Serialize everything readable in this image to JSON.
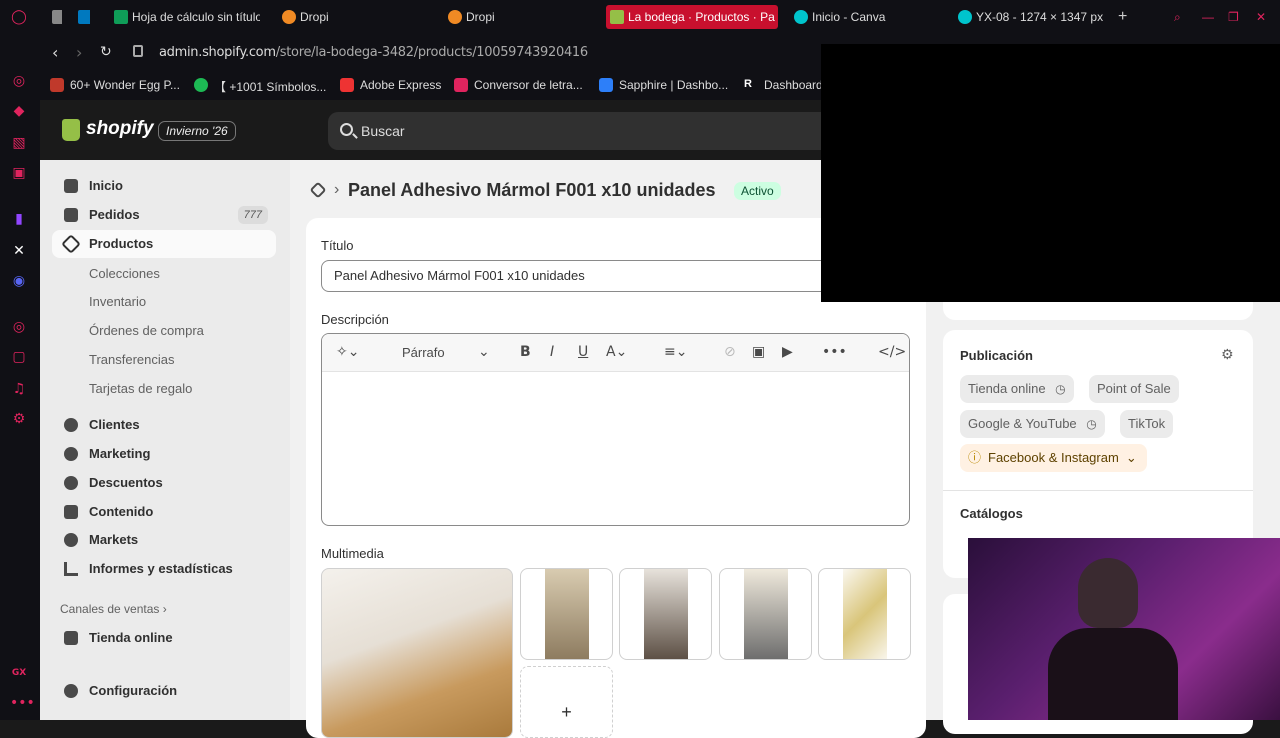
{
  "browser": {
    "tabs": [
      {
        "label": "Hoja de cálculo sin título",
        "color": "#0f9d58"
      },
      {
        "label": "Dropi",
        "color": "#f08a24"
      },
      {
        "label": "Dropi",
        "color": "#f08a24"
      },
      {
        "label": "La bodega · Productos · Pa",
        "color": "#95bf47"
      },
      {
        "label": "Inicio - Canva",
        "color": "#00c4cc"
      },
      {
        "label": "YX-08 - 1274 × 1347 px",
        "color": "#00c4cc"
      }
    ],
    "url_domain": "admin.shopify.com",
    "url_path": "/store/la-bodega-3482/products/10059743920416",
    "bookmarks": [
      {
        "label": "60+ Wonder Egg P...",
        "color": "#c0392b"
      },
      {
        "label": "【 +1001 Símbolos...",
        "color": "#1db954"
      },
      {
        "label": "Adobe Express",
        "color": "#e33"
      },
      {
        "label": "Conversor de letra...",
        "color": "#e0245e"
      },
      {
        "label": "Sapphire | Dashbo...",
        "color": "#2d7ff9"
      },
      {
        "label": "Dashboard",
        "color": "#ffffff"
      }
    ]
  },
  "header": {
    "logo": "shopify",
    "edition": "Invierno '26",
    "search_placeholder": "Buscar"
  },
  "nav": {
    "items": [
      {
        "label": "Inicio"
      },
      {
        "label": "Pedidos",
        "badge": "777"
      },
      {
        "label": "Productos"
      }
    ],
    "product_sub": [
      "Colecciones",
      "Inventario",
      "Órdenes de compra",
      "Transferencias",
      "Tarjetas de regalo"
    ],
    "items2": [
      {
        "label": "Clientes"
      },
      {
        "label": "Marketing"
      },
      {
        "label": "Descuentos"
      },
      {
        "label": "Contenido"
      },
      {
        "label": "Markets"
      },
      {
        "label": "Informes y estadísticas"
      }
    ],
    "channels_heading": "Canales de ventas",
    "channels": [
      {
        "label": "Tienda online"
      }
    ],
    "settings": "Configuración"
  },
  "product": {
    "title": "Panel Adhesivo Mármol F001 x10 unidades",
    "status": "Activo",
    "title_label": "Título",
    "title_value": "Panel Adhesivo Mármol F001 x10 unidades",
    "description_label": "Descripción",
    "paragraph_style": "Párrafo",
    "media_label": "Multimedia",
    "add_media": "+"
  },
  "publication": {
    "heading": "Publicación",
    "channels": [
      "Tienda online",
      "Point of Sale",
      "Google & YouTube",
      "TikTok",
      "Facebook & Instagram"
    ],
    "catalogs_heading": "Catálogos"
  }
}
